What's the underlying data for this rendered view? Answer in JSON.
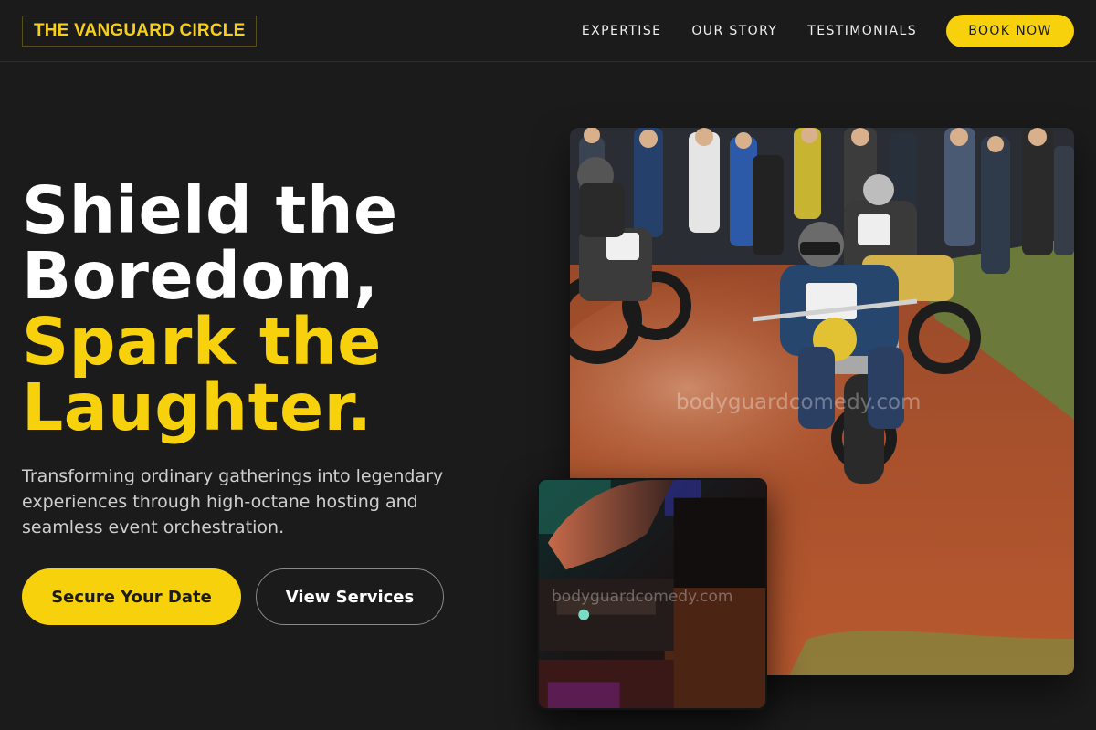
{
  "brand": {
    "name": "THE VANGUARD CIRCLE"
  },
  "nav": {
    "links": [
      "EXPERTISE",
      "OUR STORY",
      "TESTIMONIALS"
    ],
    "cta_label": "BOOK NOW"
  },
  "hero": {
    "title_line1": "Shield the",
    "title_line2": "Boredom,",
    "title_line3": "Spark the",
    "title_line4": "Laughter.",
    "description": "Transforming ordinary gatherings into legendary experiences through high-octane hosting and seamless event orchestration.",
    "primary_label": "Secure Your Date",
    "secondary_label": "View Services"
  },
  "images": {
    "main_watermark": "bodyguardcomedy.com",
    "small_watermark": "bodyguardcomedy.com"
  },
  "colors": {
    "background": "#1b1b1b",
    "accent": "#f7d10c",
    "text": "#ffffff",
    "muted_text": "#cfcfcf"
  }
}
